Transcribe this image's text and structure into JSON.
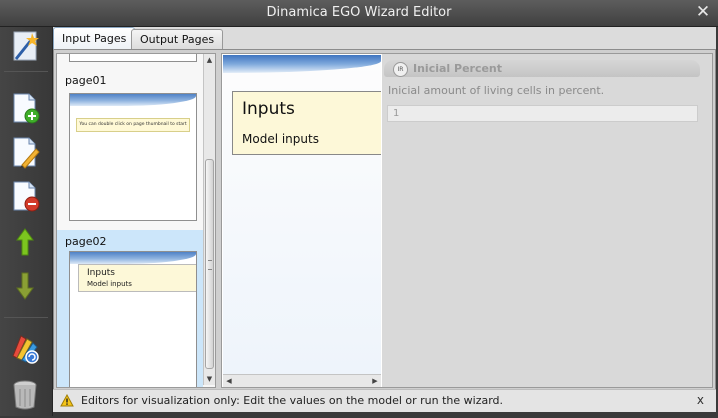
{
  "window": {
    "title": "Dinamica EGO Wizard Editor"
  },
  "tabs": [
    {
      "label": "Input Pages",
      "active": true
    },
    {
      "label": "Output Pages",
      "active": false
    }
  ],
  "page_list": {
    "items": [
      {
        "label": "page01",
        "thumb_note": "You can double click on page thumbnail to start editing"
      },
      {
        "label": "page02",
        "selected": true,
        "card_title": "Inputs",
        "card_subtitle": "Model inputs"
      }
    ]
  },
  "preview": {
    "card_title": "Inputs",
    "card_subtitle": "Model inputs"
  },
  "editor": {
    "badge": "IR",
    "title": "Inicial Percent",
    "description": "Inicial amount of living cells in percent.",
    "value": "1"
  },
  "status": {
    "message": "Editors for visualization only: Edit the values on the model or run the wizard.",
    "close_label": "x"
  },
  "icons": {
    "toolbar": [
      "wand-icon",
      "add-page-icon",
      "edit-page-icon",
      "remove-page-icon",
      "move-up-icon",
      "move-down-icon",
      "palette-icon",
      "trash-icon"
    ]
  },
  "colors": {
    "accent_blue": "#4f82c6",
    "add_green": "#3fae2a",
    "remove_red": "#d23a2a",
    "arrow_up": "#7cc51f",
    "arrow_down": "#8aa034",
    "card_yellow": "#fdf8d8",
    "selected_row": "#cce6fa"
  }
}
